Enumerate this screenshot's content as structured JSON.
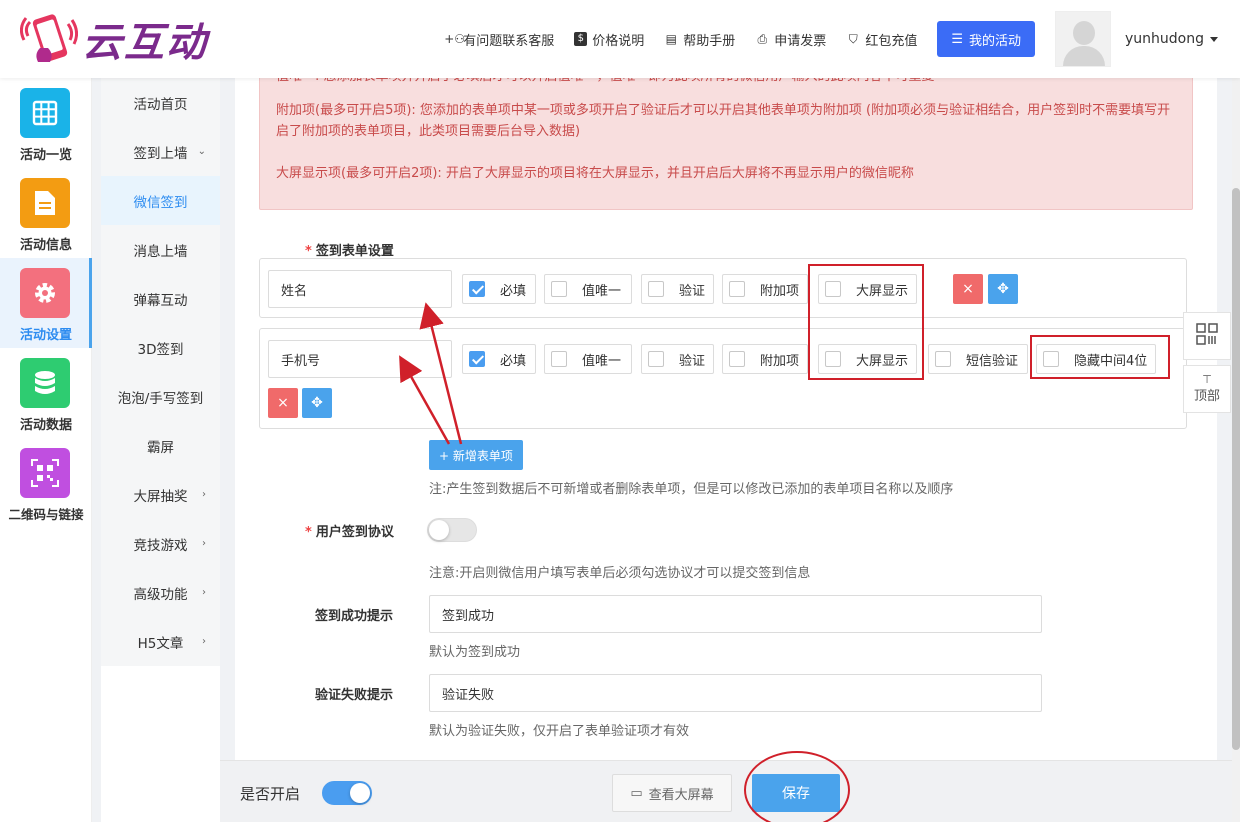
{
  "brand": {
    "name": "云互动"
  },
  "nav": {
    "support": "有问题联系客服",
    "pricing": "价格说明",
    "manual": "帮助手册",
    "invoice": "申请发票",
    "redpack": "红包充值",
    "my_activity": "我的活动",
    "username": "yunhudong"
  },
  "rail": [
    {
      "label": "活动一览",
      "icon": "grid-icon",
      "color": "#1ab3e8"
    },
    {
      "label": "活动信息",
      "icon": "document-icon",
      "color": "#f39c12"
    },
    {
      "label": "活动设置",
      "icon": "gear-icon",
      "color": "#f3707e"
    },
    {
      "label": "活动数据",
      "icon": "database-icon",
      "color": "#2ecc71"
    },
    {
      "label": "二维码与链接",
      "icon": "qrcode-icon",
      "color": "#c04fe0"
    }
  ],
  "submenu": [
    {
      "label": "活动首页"
    },
    {
      "label": "签到上墙"
    },
    {
      "label": "微信签到"
    },
    {
      "label": "消息上墙"
    },
    {
      "label": "弹幕互动"
    },
    {
      "label": "3D签到"
    },
    {
      "label": "泡泡/手写签到"
    },
    {
      "label": "霸屏"
    },
    {
      "label": "大屏抽奖"
    },
    {
      "label": "竞技游戏"
    },
    {
      "label": "高级功能"
    },
    {
      "label": "H5文章"
    }
  ],
  "alert": {
    "line1": "值唯一: 您添加表单项并开启了必填后才可以开启值唯一，值唯一即为此项所有的微信用户输入的此项内容不可重复",
    "line2": "附加项(最多可开启5项): 您添加的表单项中某一项或多项开启了验证后才可以开启其他表单项为附加项 (附加项必须与验证相结合，用户签到时不需要填写开启了附加项的表单项目，此类项目需要后台导入数据)",
    "line3": "大屏显示项(最多可开启2项): 开启了大屏显示的项目将在大屏显示，并且开启后大屏将不再显示用户的微信昵称"
  },
  "form": {
    "section_label": "签到表单设置",
    "row1": {
      "name": "姓名",
      "required": "必填",
      "unique": "值唯一",
      "verify": "验证",
      "extra": "附加项",
      "bigscreen": "大屏显示"
    },
    "row2": {
      "name": "手机号",
      "required": "必填",
      "unique": "值唯一",
      "verify": "验证",
      "extra": "附加项",
      "bigscreen": "大屏显示",
      "sms": "短信验证",
      "hide_mid": "隐藏中间4位"
    },
    "add_button": "+ 新增表单项",
    "add_note": "注:产生签到数据后不可新增或者删除表单项，但是可以修改已添加的表单项目名称以及顺序",
    "agreement_label": "用户签到协议",
    "agreement_note": "注意:开启则微信用户填写表单后必须勾选协议才可以提交签到信息",
    "success_label": "签到成功提示",
    "success_value": "签到成功",
    "success_note": "默认为签到成功",
    "fail_label": "验证失败提示",
    "fail_value": "验证失败",
    "fail_note": "默认为验证失败，仅开启了表单验证项才有效"
  },
  "footer": {
    "enabled_label": "是否开启",
    "view_screen": "查看大屏幕",
    "save": "保存"
  },
  "float": {
    "top": "顶部"
  },
  "colors": {
    "accent": "#4aa3ec",
    "primary": "#3b6cf6",
    "annotation": "#d0202a"
  }
}
